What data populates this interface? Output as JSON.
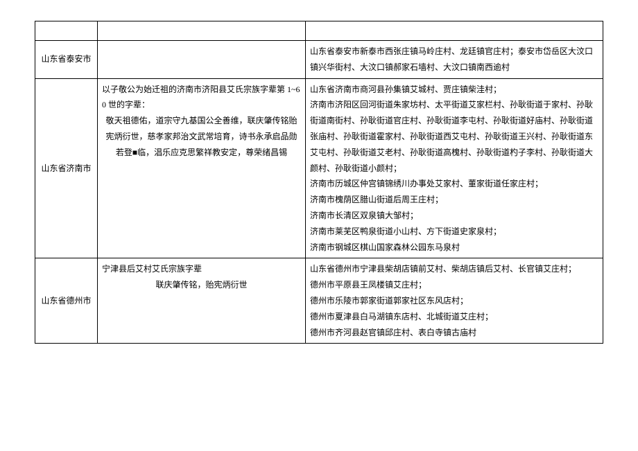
{
  "rows": [
    {
      "region": "山东省泰安市",
      "genealogy": "",
      "villages": "山东省泰安市新泰市西张庄镇马岭庄村、龙廷镇官庄村；泰安市岱岳区大汶口镇兴华街村、大汶口镇郝家石墙村、大汶口镇南西逾村"
    },
    {
      "region": "山东省济南市",
      "genealogy_title": "以子敬公为始迁祖的济南市济阳县艾氏宗族字辈第 1~60 世的字辈：",
      "genealogy_lines": [
        "敬天祖德佑，道宗守九基国公全善维，联庆肇传铭贻",
        "宪炳衍世，慈孝家邦治文武常培育，诗书永承启品勋",
        "若登■临，淐乐应克思繁祥教安定，尊荣绪昌锡"
      ],
      "villages": "山东省济南市商河县孙集镇艾城村、贾庄镇柴洼村；\n济南市济阳区回河街道朱家坊村、太平街道艾家栏村、孙耿街道于家村、孙耿街道南街村、孙耿街道官庄村、孙耿街道李屯村、孙耿街道好庙村、孙耿街道张庙村、孙耿街道霍家村、孙耿街道西艾屯村、孙耿街道王兴村、孙耿街道东艾屯村、孙耿街道艾老村、孙耿街道高槐村、孙耿街道杓子李村、孙耿街道大颜村、孙耿街道小颜村；\n济南市历城区仲宫镇锦绣川办事处艾家村、董家街道任家庄村；\n济南市槐荫区腊山街道后周王庄村；\n济南市长清区双泉镇大邹村；\n济南市莱芜区鸭泉街道小山村、方下街道史家泉村；\n济南市钢城区棋山国家森林公园东马泉村"
    },
    {
      "region": "山东省德州市",
      "genealogy_title": "宁津县后艾村艾氏宗族字辈",
      "genealogy_lines": [
        "联庆肇传铭，贻宪炳衍世"
      ],
      "villages": "山东省德州市宁津县柴胡店镇前艾村、柴胡店镇后艾村、长官镇艾庄村；\n德州市平原县王凤楼镇艾庄村；\n德州市乐陵市郭家街道郭家社区东风店村；\n德州市夏津县白马湖镇东店村、北城街道艾庄村；\n德州市齐河县赵官镇邱庄村、表白寺镇古庙村"
    }
  ]
}
